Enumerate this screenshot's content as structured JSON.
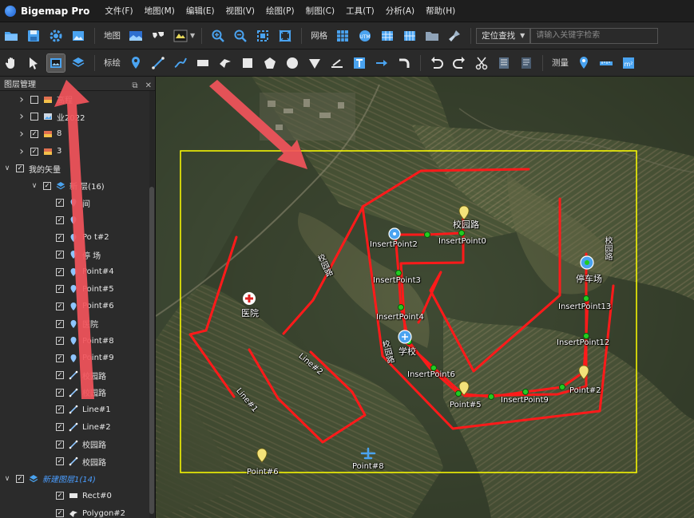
{
  "app": {
    "title": "Bigemap Pro"
  },
  "menu": [
    "文件(F)",
    "地图(M)",
    "编辑(E)",
    "视图(V)",
    "绘图(P)",
    "制图(C)",
    "工具(T)",
    "分析(A)",
    "帮助(H)"
  ],
  "toolbar1": {
    "map_label": "地图",
    "grid_label": "网格",
    "locate_label": "定位查找",
    "search_placeholder": "请输入关键字检索"
  },
  "toolbar2": {
    "draw_label": "标绘",
    "measure_label": "测量"
  },
  "layer_panel": {
    "title": "图层管理",
    "items": [
      {
        "label": "高程",
        "expander": ">",
        "checked": false,
        "indent": 0,
        "icon": "raster-layer-icon"
      },
      {
        "label": "业2022",
        "expander": ">",
        "checked": false,
        "indent": 0,
        "icon": "image-layer-icon"
      },
      {
        "label": "8",
        "expander": ">",
        "checked": true,
        "indent": 0,
        "icon": "raster-layer-icon"
      },
      {
        "label": "3",
        "expander": ">",
        "checked": true,
        "indent": 0,
        "icon": "raster-layer-icon"
      },
      {
        "label": "我的矢量",
        "expander": "v",
        "checked": true,
        "indent": 0,
        "icon": ""
      },
      {
        "label": "新 层(16)",
        "expander": "v",
        "checked": true,
        "indent": 1,
        "icon": "layers-icon"
      },
      {
        "label": "间",
        "expander": "",
        "checked": true,
        "indent": 2,
        "icon": "point-icon"
      },
      {
        "label": "",
        "expander": "",
        "checked": true,
        "indent": 2,
        "icon": "point-icon"
      },
      {
        "label": "Po t#2",
        "expander": "",
        "checked": true,
        "indent": 2,
        "icon": "point-icon"
      },
      {
        "label": "停 场",
        "expander": "",
        "checked": true,
        "indent": 2,
        "icon": "point-icon"
      },
      {
        "label": "Point#4",
        "expander": "",
        "checked": true,
        "indent": 2,
        "icon": "point-icon"
      },
      {
        "label": "Point#5",
        "expander": "",
        "checked": true,
        "indent": 2,
        "icon": "point-icon"
      },
      {
        "label": "Point#6",
        "expander": "",
        "checked": true,
        "indent": 2,
        "icon": "point-icon"
      },
      {
        "label": "医院",
        "expander": "",
        "checked": true,
        "indent": 2,
        "icon": "point-icon"
      },
      {
        "label": "Point#8",
        "expander": "",
        "checked": true,
        "indent": 2,
        "icon": "point-icon"
      },
      {
        "label": "Point#9",
        "expander": "",
        "checked": true,
        "indent": 2,
        "icon": "point-icon"
      },
      {
        "label": "校园路",
        "expander": "",
        "checked": true,
        "indent": 2,
        "icon": "line-icon"
      },
      {
        "label": "校园路",
        "expander": "",
        "checked": true,
        "indent": 2,
        "icon": "line-icon"
      },
      {
        "label": "Line#1",
        "expander": "",
        "checked": true,
        "indent": 2,
        "icon": "line-icon"
      },
      {
        "label": "Line#2",
        "expander": "",
        "checked": true,
        "indent": 2,
        "icon": "line-icon"
      },
      {
        "label": "校园路",
        "expander": "",
        "checked": true,
        "indent": 2,
        "icon": "line-icon"
      },
      {
        "label": "校园路",
        "expander": "",
        "checked": true,
        "indent": 2,
        "icon": "line-icon"
      },
      {
        "label": "新建图层1(14)",
        "expander": "v",
        "checked": true,
        "indent": 0,
        "icon": "layers-icon",
        "style": "italic-blue"
      },
      {
        "label": "Rect#0",
        "expander": "",
        "checked": true,
        "indent": 2,
        "icon": "rect-icon"
      },
      {
        "label": "Polygon#2",
        "expander": "",
        "checked": true,
        "indent": 2,
        "icon": "polygon-icon"
      }
    ]
  },
  "map": {
    "labels": {
      "xiaoyuanlu_top": "校园路",
      "insert_point0": "InsertPoint0",
      "insert_point2": "InsertPoint2",
      "insert_point3": "InsertPoint3",
      "insert_point4": "InsertPoint4",
      "insert_point6": "InsertPoint6",
      "insert_point9": "InsertPoint9",
      "insert_point12": "InsertPoint12",
      "insert_point13": "InsertPoint13",
      "point5": "Point#5",
      "point2": "Point#2",
      "point6": "Point#6",
      "point8": "Point#8",
      "school": "学校",
      "parking": "停车场",
      "hospital": "医院",
      "road_left": "校园路",
      "road_mid": "校园路",
      "road_right": "校园路",
      "line1": "Line#1",
      "line2": "Line#2"
    },
    "colors": {
      "route": "#ff1a1a",
      "vertex": "#22cc22",
      "frame": "#ffff00",
      "annotation_arrow": "#f2545b"
    }
  }
}
